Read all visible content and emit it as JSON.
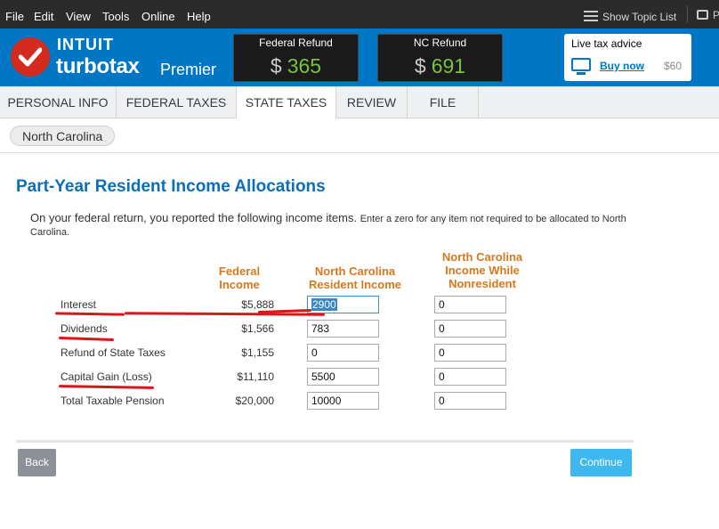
{
  "menu": {
    "items": [
      "File",
      "Edit",
      "View",
      "Tools",
      "Online",
      "Help"
    ],
    "show_topic_list": "Show Topic List",
    "trailing": "P"
  },
  "brand": {
    "company": "INTUIT",
    "product": "turbotax",
    "edition": "Premier",
    "accent_color": "#0077c5",
    "logo_color": "#d52b1e"
  },
  "refunds": {
    "federal": {
      "label": "Federal Refund",
      "currency": "$",
      "amount": "365"
    },
    "state": {
      "label": "NC Refund",
      "currency": "$",
      "amount": "691"
    },
    "amount_color": "#7ac143"
  },
  "live_advice": {
    "title": "Live tax advice",
    "link": "Buy now",
    "price": "$60"
  },
  "tabs": [
    {
      "label": "PERSONAL INFO",
      "active": false
    },
    {
      "label": "FEDERAL TAXES",
      "active": false
    },
    {
      "label": "STATE TAXES",
      "active": true
    },
    {
      "label": "REVIEW",
      "active": false
    },
    {
      "label": "FILE",
      "active": false
    }
  ],
  "state_pill": "North Carolina",
  "page": {
    "title": "Part-Year Resident Income Allocations",
    "intro_main": "On your federal return, you reported the following income items.",
    "intro_small": "Enter a zero for any item not required to be allocated to North Carolina."
  },
  "columns": {
    "federal": "Federal Income",
    "resident": "North Carolina Resident Income",
    "nonresident": "North Carolina Income While Nonresident"
  },
  "rows": [
    {
      "label": "Interest",
      "federal": "$5,888",
      "resident": "2900",
      "nonresident": "0"
    },
    {
      "label": "Dividends",
      "federal": "$1,566",
      "resident": "783",
      "nonresident": "0"
    },
    {
      "label": "Refund of State Taxes",
      "federal": "$1,155",
      "resident": "0",
      "nonresident": "0"
    },
    {
      "label": "Capital Gain (Loss)",
      "federal": "$11,110",
      "resident": "5500",
      "nonresident": "0"
    },
    {
      "label": "Total Taxable Pension",
      "federal": "$20,000",
      "resident": "10000",
      "nonresident": "0"
    }
  ],
  "annotation_color": "#d9161c",
  "buttons": {
    "back": "Back",
    "continue": "Continue"
  }
}
